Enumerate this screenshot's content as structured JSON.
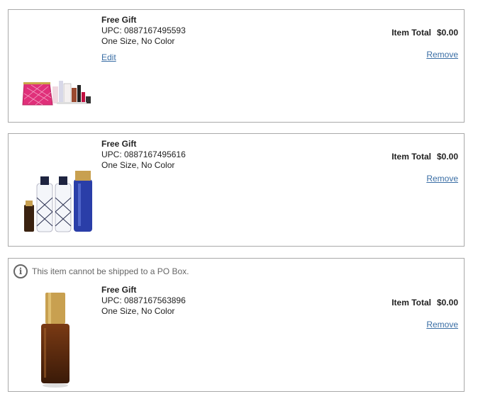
{
  "items": [
    {
      "title": "Free Gift",
      "upc": "UPC: 0887167495593",
      "variant": "One Size, No Color",
      "edit_label": "Edit",
      "total_label": "Item Total",
      "total_value": "$0.00",
      "remove_label": "Remove"
    },
    {
      "title": "Free Gift",
      "upc": "UPC: 0887167495616",
      "variant": "One Size, No Color",
      "total_label": "Item Total",
      "total_value": "$0.00",
      "remove_label": "Remove"
    },
    {
      "notice": "This item cannot be shipped to a PO Box.",
      "notice_icon": "info-icon",
      "title": "Free Gift",
      "upc": "UPC: 0887167563896",
      "variant": "One Size, No Color",
      "total_label": "Item Total",
      "total_value": "$0.00",
      "remove_label": "Remove"
    }
  ],
  "colors": {
    "link": "#3a6ea5",
    "border": "#a9a9a9",
    "muted": "#666666"
  }
}
